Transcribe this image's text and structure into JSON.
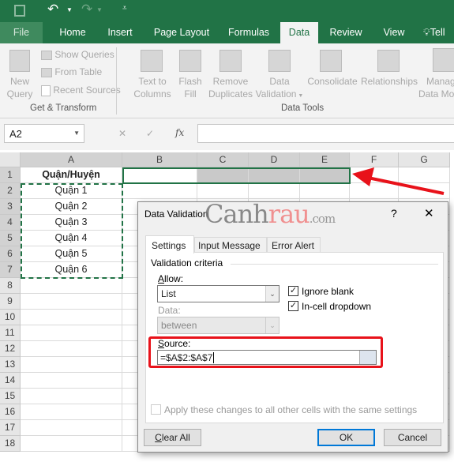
{
  "qat": {
    "save_icon": "save-icon",
    "undo_icon": "undo-icon",
    "redo_icon": "redo-icon",
    "customize_icon": "customize-icon"
  },
  "tabs": [
    {
      "label": "File"
    },
    {
      "label": "Home"
    },
    {
      "label": "Insert"
    },
    {
      "label": "Page Layout"
    },
    {
      "label": "Formulas"
    },
    {
      "label": "Data"
    },
    {
      "label": "Review"
    },
    {
      "label": "View"
    },
    {
      "label": "Tell"
    }
  ],
  "ribbon": {
    "new_query": "New",
    "new_query2": "Query",
    "show_queries": "Show Queries",
    "from_table": "From Table",
    "recent_sources": "Recent Sources",
    "group1": "Get & Transform",
    "text_to_columns": [
      "Text to",
      "Columns"
    ],
    "flash_fill": [
      "Flash",
      "Fill"
    ],
    "remove_duplicates": [
      "Remove",
      "Duplicates"
    ],
    "data_validation": [
      "Data",
      "Validation"
    ],
    "consolidate": "Consolidate",
    "relationships": "Relationships",
    "manage": [
      "Manag",
      "Data Mo"
    ],
    "group2": "Data Tools"
  },
  "formula_bar": {
    "name_box": "A2",
    "fx": "fx",
    "cancel": "✕",
    "enter": "✓",
    "value": ""
  },
  "columns": [
    "A",
    "B",
    "C",
    "D",
    "E",
    "F",
    "G"
  ],
  "rows": [
    "1",
    "2",
    "3",
    "4",
    "5",
    "6",
    "7",
    "8",
    "9",
    "10",
    "11",
    "12",
    "13",
    "14",
    "15",
    "16",
    "17",
    "18"
  ],
  "cells": {
    "A1": "Quận/Huyện",
    "A2": "Quận 1",
    "A3": "Quận 2",
    "A4": "Quận 3",
    "A5": "Quận 4",
    "A6": "Quận 5",
    "A7": "Quận 6"
  },
  "watermark": {
    "part1": "Canh",
    "part2": "rau",
    "part3": ".com"
  },
  "dialog": {
    "title": "Data Validation",
    "help": "?",
    "close": "✕",
    "tabs": [
      "Settings",
      "Input Message",
      "Error Alert"
    ],
    "criteria": "Validation criteria",
    "allow_label": "Allow:",
    "allow_value": "List",
    "data_label": "Data:",
    "data_value": "between",
    "ignore_blank": "Ignore blank",
    "ignore_blank_checked": true,
    "in_cell_dropdown": "In-cell dropdown",
    "in_cell_dropdown_checked": true,
    "source_label": "Source:",
    "source_value": "=$A$2:$A$7",
    "apply_all": "Apply these changes to all other cells with the same settings",
    "apply_all_checked": false,
    "clear_all": "Clear All",
    "ok": "OK",
    "cancel": "Cancel"
  },
  "colors": {
    "excel_green": "#217346",
    "highlight_red": "#e8121a",
    "ok_border": "#0078d7"
  }
}
